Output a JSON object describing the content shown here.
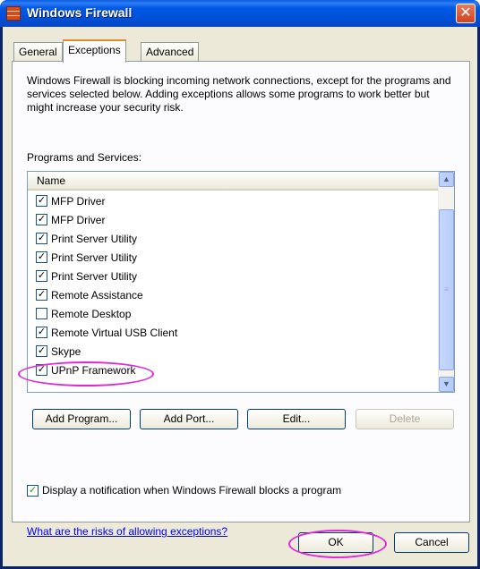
{
  "window": {
    "title": "Windows Firewall",
    "close_glyph": "✕",
    "title_icon": "firewall-icon"
  },
  "tabs": [
    {
      "label": "General",
      "active": false
    },
    {
      "label": "Exceptions",
      "active": true
    },
    {
      "label": "Advanced",
      "active": false
    }
  ],
  "description": "Windows Firewall is blocking incoming network connections, except for the programs and services selected below. Adding exceptions allows some programs to work better but might increase your security risk.",
  "programs_label": "Programs and Services:",
  "list": {
    "header": "Name",
    "items": [
      {
        "label": "MFP Driver",
        "checked": true
      },
      {
        "label": "MFP Driver",
        "checked": true
      },
      {
        "label": "Print Server Utility",
        "checked": true
      },
      {
        "label": "Print Server Utility",
        "checked": true
      },
      {
        "label": "Print Server Utility",
        "checked": true
      },
      {
        "label": "Remote Assistance",
        "checked": true
      },
      {
        "label": "Remote Desktop",
        "checked": false
      },
      {
        "label": "Remote Virtual USB Client",
        "checked": true
      },
      {
        "label": "Skype",
        "checked": true
      },
      {
        "label": "UPnP Framework",
        "checked": true
      }
    ],
    "scroll_up_glyph": "▲",
    "scroll_down_glyph": "▼",
    "scroll_thumb_glyph": "≡"
  },
  "buttons": {
    "add_program": "Add Program...",
    "add_port": "Add Port...",
    "edit": "Edit...",
    "delete": "Delete",
    "ok": "OK",
    "cancel": "Cancel"
  },
  "notify": {
    "label": "Display a notification when Windows Firewall blocks a program",
    "checked": true
  },
  "risk_link": "What are the risks of allowing exceptions?",
  "colors": {
    "titlebar": "#0058e4",
    "dialog_bg": "#ece9d8",
    "highlight_ellipse": "#e028d8",
    "link": "#0000ff"
  }
}
